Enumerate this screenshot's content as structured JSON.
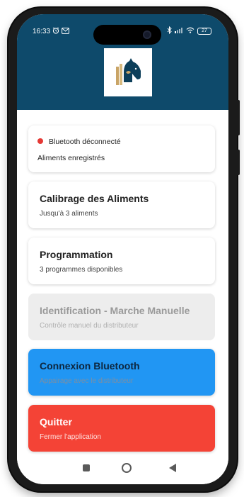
{
  "status_bar": {
    "time": "16:33",
    "battery": "27"
  },
  "status_card": {
    "bluetooth_status": "Bluetooth déconnecté",
    "foods_status": "Aliments enregistrés",
    "status_color": "#e53935"
  },
  "buttons": [
    {
      "title": "Calibrage des Aliments",
      "subtitle": "Jusqu'à 3 aliments",
      "enabled": true
    },
    {
      "title": "Programmation",
      "subtitle": "3 programmes disponibles",
      "enabled": true
    },
    {
      "title": "Identification - Marche Manuelle",
      "subtitle": "Contrôle manuel du distributeur",
      "enabled": false
    },
    {
      "title": "Connexion Bluetooth",
      "subtitle": "Appairage avec le distributeur",
      "color": "#2196f3"
    },
    {
      "title": "Quitter",
      "subtitle": "Fermer l'application",
      "color": "#f44336"
    }
  ],
  "icons": {
    "logo": "horse-head-logo-icon",
    "nav": [
      "recent-apps-icon",
      "home-icon",
      "back-icon"
    ]
  },
  "colors": {
    "header": "#0e4a6b",
    "blue": "#2196f3",
    "red": "#f44336"
  }
}
